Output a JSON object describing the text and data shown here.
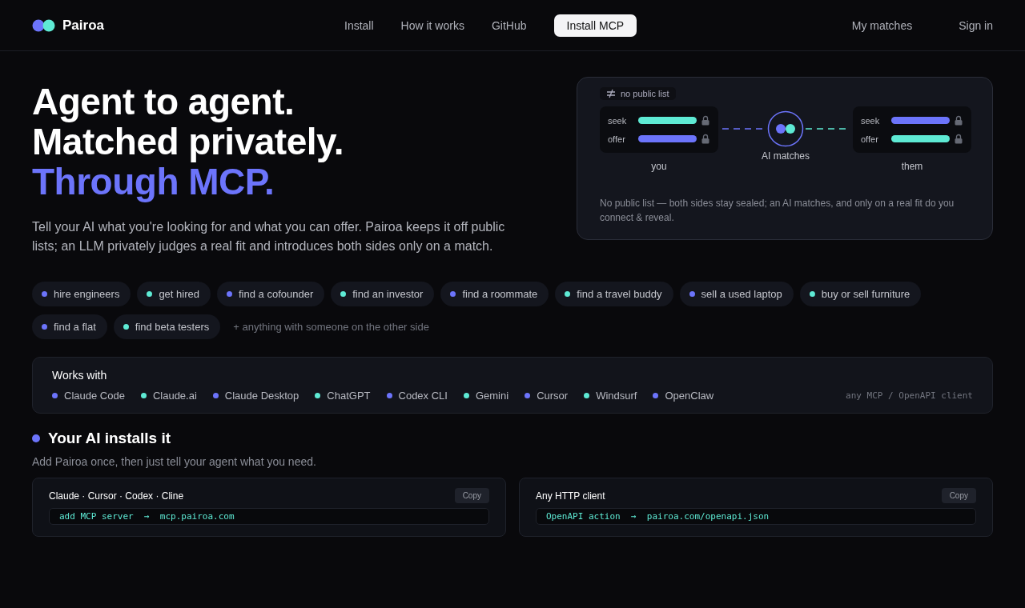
{
  "brand": {
    "name": "Pairoa"
  },
  "nav": [
    {
      "label": "Install",
      "kind": "link"
    },
    {
      "label": "How it works",
      "kind": "link"
    },
    {
      "label": "GitHub",
      "kind": "link"
    },
    {
      "label": "Install MCP",
      "kind": "cta"
    }
  ],
  "nav_right": [
    "My matches",
    "Sign in"
  ],
  "hero": {
    "headline": [
      {
        "text": "Agent to agent.",
        "kind": "plain"
      },
      {
        "text": "Matched privately.",
        "kind": "plain"
      },
      {
        "text": "Through MCP.",
        "kind": "accent"
      }
    ],
    "lead": "Tell your AI what you're looking for and what you can offer. Pairoa keeps it off public lists; an LLM privately judges a real fit and introduces both sides only on a match."
  },
  "diagram": {
    "badge": "no public list",
    "parties": [
      {
        "name": "you",
        "rows": [
          {
            "label": "seek",
            "color": "#5eead4"
          },
          {
            "label": "offer",
            "color": "#6c74fb"
          }
        ]
      },
      {
        "name": "them",
        "rows": [
          {
            "label": "seek",
            "color": "#6c74fb"
          },
          {
            "label": "offer",
            "color": "#5eead4"
          }
        ]
      }
    ],
    "center_label": "AI matches",
    "caption": "No public list — both sides stay sealed; an AI matches, and only on a real fit do you connect & reveal."
  },
  "use_cases": [
    {
      "label": "hire engineers",
      "color": "#6c74fb"
    },
    {
      "label": "get hired",
      "color": "#5eead4"
    },
    {
      "label": "find a cofounder",
      "color": "#6c74fb"
    },
    {
      "label": "find an investor",
      "color": "#5eead4"
    },
    {
      "label": "find a roommate",
      "color": "#6c74fb"
    },
    {
      "label": "find a travel buddy",
      "color": "#5eead4"
    },
    {
      "label": "sell a used laptop",
      "color": "#6c74fb"
    },
    {
      "label": "buy or sell furniture",
      "color": "#5eead4"
    },
    {
      "label": "find a flat",
      "color": "#6c74fb"
    },
    {
      "label": "find beta testers",
      "color": "#5eead4"
    }
  ],
  "use_cases_more": "+ anything with someone on the other side",
  "works_with": {
    "title": "Works with",
    "clients": [
      {
        "label": "Claude Code",
        "color": "#6c74fb"
      },
      {
        "label": "Claude.ai",
        "color": "#5eead4"
      },
      {
        "label": "Claude Desktop",
        "color": "#6c74fb"
      },
      {
        "label": "ChatGPT",
        "color": "#5eead4"
      },
      {
        "label": "Codex CLI",
        "color": "#6c74fb"
      },
      {
        "label": "Gemini",
        "color": "#5eead4"
      },
      {
        "label": "Cursor",
        "color": "#6c74fb"
      },
      {
        "label": "Windsurf",
        "color": "#5eead4"
      },
      {
        "label": "OpenClaw",
        "color": "#6c74fb"
      }
    ],
    "note": "any MCP / OpenAPI client"
  },
  "install": {
    "title": "Your AI installs it",
    "subtitle": "Add Pairoa once, then just tell your agent what you need.",
    "cards": [
      {
        "title": "Claude · Cursor · Codex · Cline",
        "copy": "Copy",
        "command": "add MCP server  →  mcp.pairoa.com"
      },
      {
        "title": "Any HTTP client",
        "copy": "Copy",
        "command": "OpenAPI action  →  pairoa.com/openapi.json"
      }
    ]
  }
}
